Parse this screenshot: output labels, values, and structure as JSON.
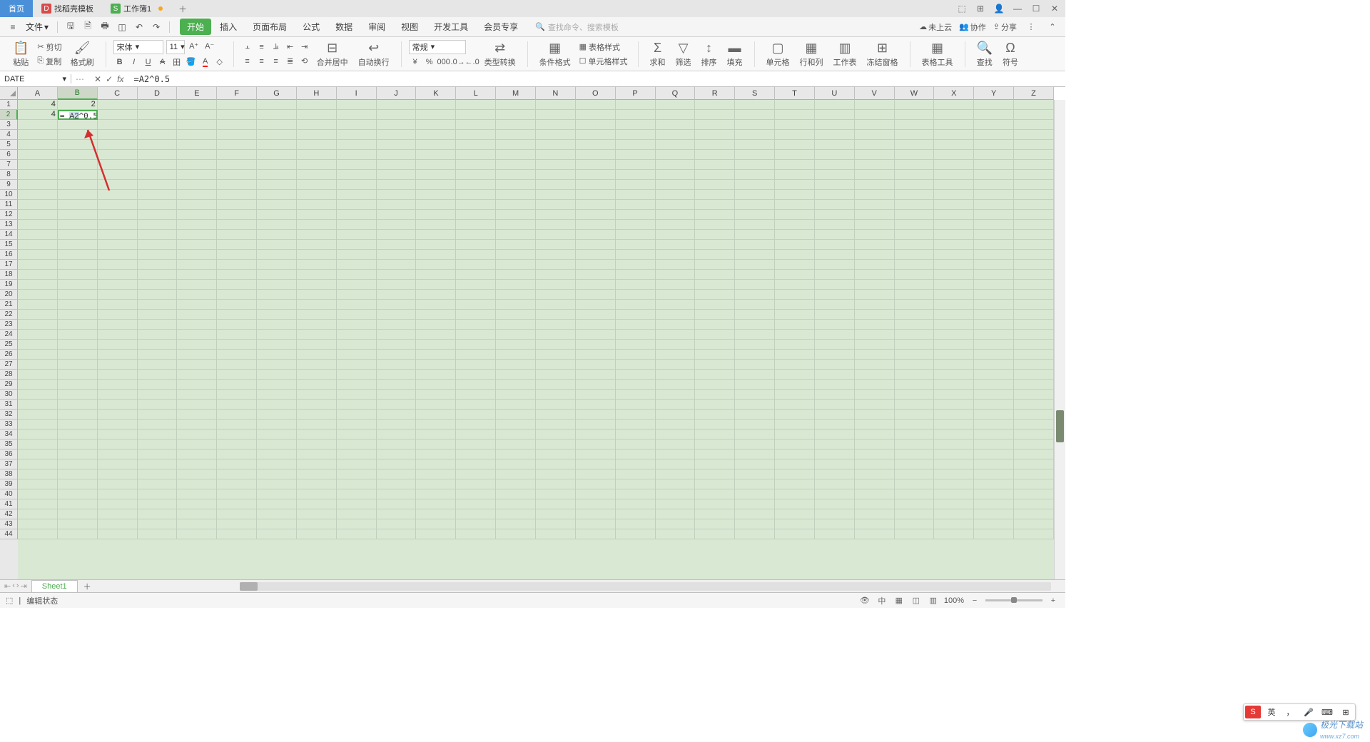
{
  "tabs": {
    "home": "首页",
    "template": "找稻壳模板",
    "workbook": "工作簿1"
  },
  "menu": {
    "file": "文件",
    "tabs": [
      "开始",
      "插入",
      "页面布局",
      "公式",
      "数据",
      "审阅",
      "视图",
      "开发工具",
      "会员专享"
    ],
    "search_placeholder": "查找命令、搜索模板",
    "cloud": "未上云",
    "collab": "协作",
    "share": "分享"
  },
  "ribbon": {
    "paste": "粘贴",
    "cut": "剪切",
    "copy": "复制",
    "format_painter": "格式刷",
    "font_name": "宋体",
    "font_size": "11",
    "merge": "合并居中",
    "wrap": "自动换行",
    "number_format": "常规",
    "type_convert": "类型转换",
    "cond_format": "条件格式",
    "table_style": "表格样式",
    "cell_style": "单元格样式",
    "sum": "求和",
    "filter": "筛选",
    "sort": "排序",
    "fill": "填充",
    "cell": "单元格",
    "row_col": "行和列",
    "worksheet": "工作表",
    "freeze": "冻结窗格",
    "table_tool": "表格工具",
    "find": "查找",
    "symbol": "符号"
  },
  "formula": {
    "name_box": "DATE",
    "value": "=A2^0.5"
  },
  "grid": {
    "columns": [
      "A",
      "B",
      "C",
      "D",
      "E",
      "F",
      "G",
      "H",
      "I",
      "J",
      "K",
      "L",
      "M",
      "N",
      "O",
      "P",
      "Q",
      "R",
      "S",
      "T",
      "U",
      "V",
      "W",
      "X",
      "Y",
      "Z"
    ],
    "rows": 44,
    "a1": "4",
    "b1": "2",
    "a2": "4",
    "b2": "= A2^0.5",
    "b2_ref": "A2",
    "active_col": "B",
    "active_row": 2
  },
  "sheet": {
    "name": "Sheet1"
  },
  "status": {
    "edit_mode": "编辑状态",
    "zoom": "100%"
  },
  "ime": {
    "lang": "英",
    "punct": "，"
  },
  "watermark": {
    "text": "极光下载站",
    "url": "www.xz7.com"
  }
}
